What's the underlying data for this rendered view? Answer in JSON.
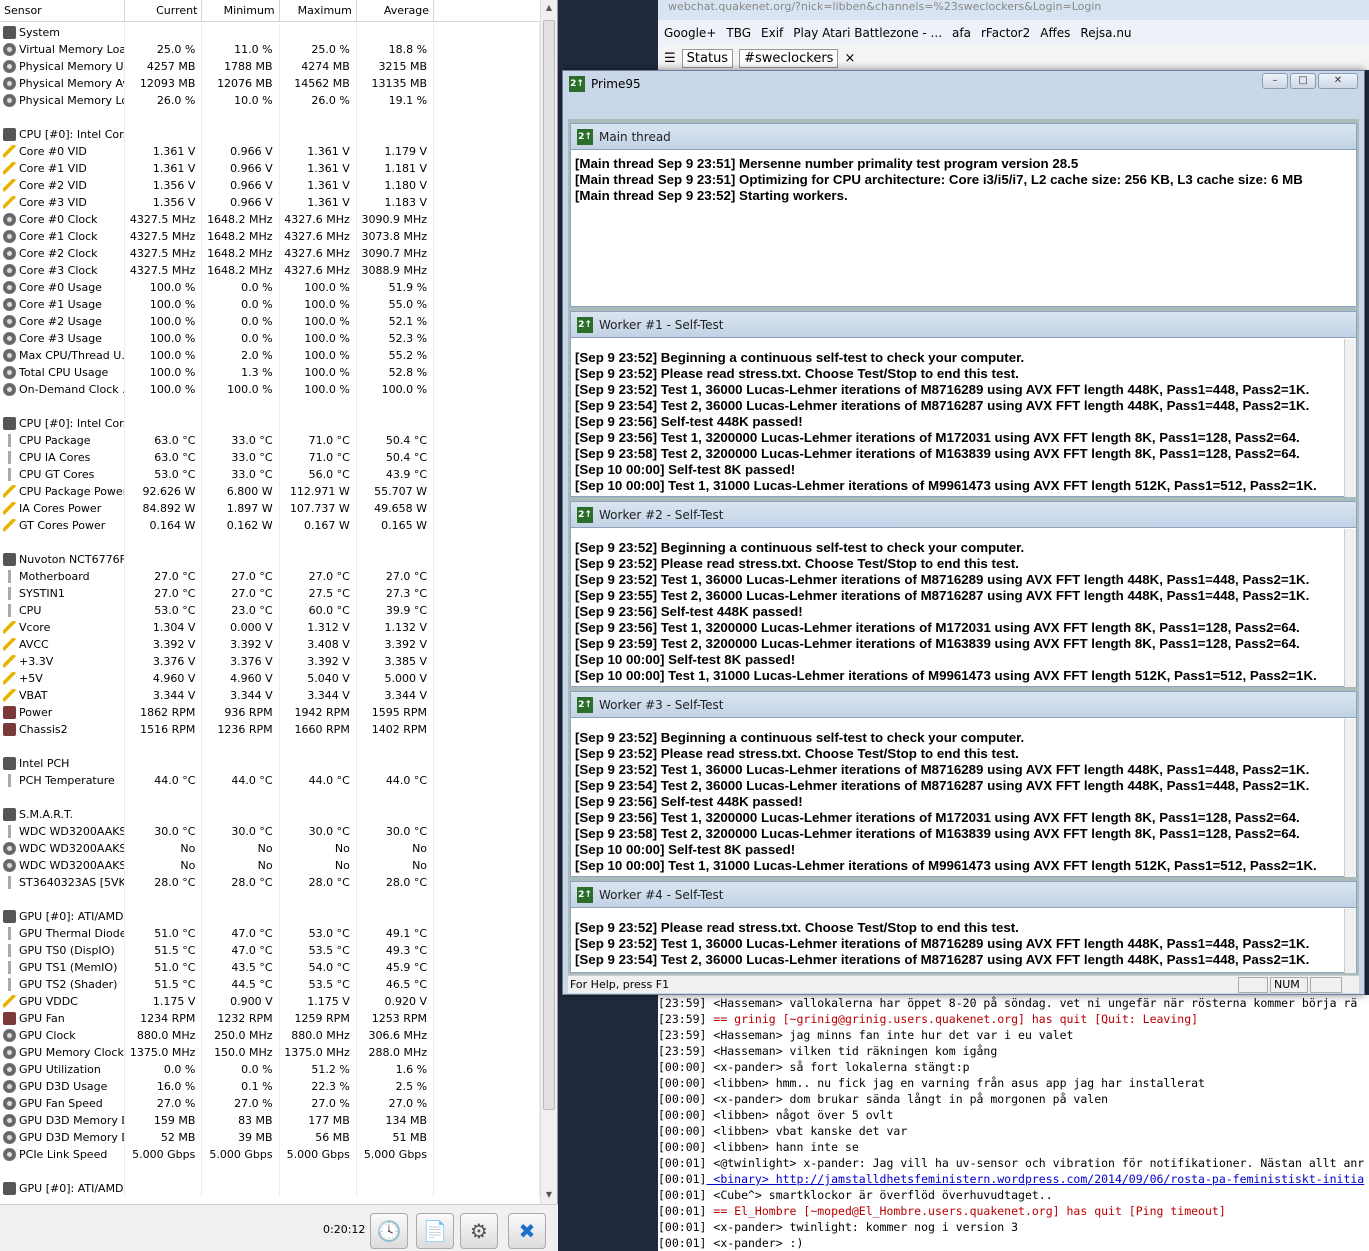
{
  "hwinfo": {
    "columns": [
      "Sensor",
      "Current",
      "Minimum",
      "Maximum",
      "Average"
    ],
    "rows": [
      {
        "icon": "chip",
        "name": "System",
        "cur": "",
        "min": "",
        "max": "",
        "avg": ""
      },
      {
        "icon": "disk",
        "name": "Virtual Memory Load",
        "cur": "25.0 %",
        "min": "11.0 %",
        "max": "25.0 %",
        "avg": "18.8 %"
      },
      {
        "icon": "disk",
        "name": "Physical Memory Used",
        "cur": "4257 MB",
        "min": "1788 MB",
        "max": "4274 MB",
        "avg": "3215 MB"
      },
      {
        "icon": "disk",
        "name": "Physical Memory Av...",
        "cur": "12093 MB",
        "min": "12076 MB",
        "max": "14562 MB",
        "avg": "13135 MB"
      },
      {
        "icon": "disk",
        "name": "Physical Memory Load",
        "cur": "26.0 %",
        "min": "10.0 %",
        "max": "26.0 %",
        "avg": "19.1 %"
      },
      {
        "icon": "",
        "name": "",
        "cur": "",
        "min": "",
        "max": "",
        "avg": ""
      },
      {
        "icon": "chip",
        "name": "CPU [#0]: Intel Cor...",
        "cur": "",
        "min": "",
        "max": "",
        "avg": ""
      },
      {
        "icon": "bolt",
        "name": "Core #0 VID",
        "cur": "1.361 V",
        "min": "0.966 V",
        "max": "1.361 V",
        "avg": "1.179 V"
      },
      {
        "icon": "bolt",
        "name": "Core #1 VID",
        "cur": "1.361 V",
        "min": "0.966 V",
        "max": "1.361 V",
        "avg": "1.181 V"
      },
      {
        "icon": "bolt",
        "name": "Core #2 VID",
        "cur": "1.356 V",
        "min": "0.966 V",
        "max": "1.361 V",
        "avg": "1.180 V"
      },
      {
        "icon": "bolt",
        "name": "Core #3 VID",
        "cur": "1.356 V",
        "min": "0.966 V",
        "max": "1.361 V",
        "avg": "1.183 V"
      },
      {
        "icon": "disk",
        "name": "Core #0 Clock",
        "cur": "4327.5 MHz",
        "min": "1648.2 MHz",
        "max": "4327.6 MHz",
        "avg": "3090.9 MHz"
      },
      {
        "icon": "disk",
        "name": "Core #1 Clock",
        "cur": "4327.5 MHz",
        "min": "1648.2 MHz",
        "max": "4327.6 MHz",
        "avg": "3073.8 MHz"
      },
      {
        "icon": "disk",
        "name": "Core #2 Clock",
        "cur": "4327.5 MHz",
        "min": "1648.2 MHz",
        "max": "4327.6 MHz",
        "avg": "3090.7 MHz"
      },
      {
        "icon": "disk",
        "name": "Core #3 Clock",
        "cur": "4327.5 MHz",
        "min": "1648.2 MHz",
        "max": "4327.6 MHz",
        "avg": "3088.9 MHz"
      },
      {
        "icon": "disk",
        "name": "Core #0 Usage",
        "cur": "100.0 %",
        "min": "0.0 %",
        "max": "100.0 %",
        "avg": "51.9 %"
      },
      {
        "icon": "disk",
        "name": "Core #1 Usage",
        "cur": "100.0 %",
        "min": "0.0 %",
        "max": "100.0 %",
        "avg": "55.0 %"
      },
      {
        "icon": "disk",
        "name": "Core #2 Usage",
        "cur": "100.0 %",
        "min": "0.0 %",
        "max": "100.0 %",
        "avg": "52.1 %"
      },
      {
        "icon": "disk",
        "name": "Core #3 Usage",
        "cur": "100.0 %",
        "min": "0.0 %",
        "max": "100.0 %",
        "avg": "52.3 %"
      },
      {
        "icon": "disk",
        "name": "Max CPU/Thread U...",
        "cur": "100.0 %",
        "min": "2.0 %",
        "max": "100.0 %",
        "avg": "55.2 %"
      },
      {
        "icon": "disk",
        "name": "Total CPU Usage",
        "cur": "100.0 %",
        "min": "1.3 %",
        "max": "100.0 %",
        "avg": "52.8 %"
      },
      {
        "icon": "disk",
        "name": "On-Demand Clock ...",
        "cur": "100.0 %",
        "min": "100.0 %",
        "max": "100.0 %",
        "avg": "100.0 %"
      },
      {
        "icon": "",
        "name": "",
        "cur": "",
        "min": "",
        "max": "",
        "avg": ""
      },
      {
        "icon": "chip",
        "name": "CPU [#0]: Intel Cor...",
        "cur": "",
        "min": "",
        "max": "",
        "avg": ""
      },
      {
        "icon": "therm",
        "name": "CPU Package",
        "cur": "63.0 °C",
        "min": "33.0 °C",
        "max": "71.0 °C",
        "avg": "50.4 °C"
      },
      {
        "icon": "therm",
        "name": "CPU IA Cores",
        "cur": "63.0 °C",
        "min": "33.0 °C",
        "max": "71.0 °C",
        "avg": "50.4 °C"
      },
      {
        "icon": "therm",
        "name": "CPU GT Cores",
        "cur": "53.0 °C",
        "min": "33.0 °C",
        "max": "56.0 °C",
        "avg": "43.9 °C"
      },
      {
        "icon": "bolt",
        "name": "CPU Package Power",
        "cur": "92.626 W",
        "min": "6.800 W",
        "max": "112.971 W",
        "avg": "55.707 W"
      },
      {
        "icon": "bolt",
        "name": "IA Cores Power",
        "cur": "84.892 W",
        "min": "1.897 W",
        "max": "107.737 W",
        "avg": "49.658 W"
      },
      {
        "icon": "bolt",
        "name": "GT Cores Power",
        "cur": "0.164 W",
        "min": "0.162 W",
        "max": "0.167 W",
        "avg": "0.165 W"
      },
      {
        "icon": "",
        "name": "",
        "cur": "",
        "min": "",
        "max": "",
        "avg": ""
      },
      {
        "icon": "chip",
        "name": "Nuvoton NCT6776F",
        "cur": "",
        "min": "",
        "max": "",
        "avg": ""
      },
      {
        "icon": "therm",
        "name": "Motherboard",
        "cur": "27.0 °C",
        "min": "27.0 °C",
        "max": "27.0 °C",
        "avg": "27.0 °C"
      },
      {
        "icon": "therm",
        "name": "SYSTIN1",
        "cur": "27.0 °C",
        "min": "27.0 °C",
        "max": "27.5 °C",
        "avg": "27.3 °C"
      },
      {
        "icon": "therm",
        "name": "CPU",
        "cur": "53.0 °C",
        "min": "23.0 °C",
        "max": "60.0 °C",
        "avg": "39.9 °C"
      },
      {
        "icon": "bolt",
        "name": "Vcore",
        "cur": "1.304 V",
        "min": "0.000 V",
        "max": "1.312 V",
        "avg": "1.132 V"
      },
      {
        "icon": "bolt",
        "name": "AVCC",
        "cur": "3.392 V",
        "min": "3.392 V",
        "max": "3.408 V",
        "avg": "3.392 V"
      },
      {
        "icon": "bolt",
        "name": "+3.3V",
        "cur": "3.376 V",
        "min": "3.376 V",
        "max": "3.392 V",
        "avg": "3.385 V"
      },
      {
        "icon": "bolt",
        "name": "+5V",
        "cur": "4.960 V",
        "min": "4.960 V",
        "max": "5.040 V",
        "avg": "5.000 V"
      },
      {
        "icon": "bolt",
        "name": "VBAT",
        "cur": "3.344 V",
        "min": "3.344 V",
        "max": "3.344 V",
        "avg": "3.344 V"
      },
      {
        "icon": "fan",
        "name": "Power",
        "cur": "1862 RPM",
        "min": "936 RPM",
        "max": "1942 RPM",
        "avg": "1595 RPM"
      },
      {
        "icon": "fan",
        "name": "Chassis2",
        "cur": "1516 RPM",
        "min": "1236 RPM",
        "max": "1660 RPM",
        "avg": "1402 RPM"
      },
      {
        "icon": "",
        "name": "",
        "cur": "",
        "min": "",
        "max": "",
        "avg": ""
      },
      {
        "icon": "chip",
        "name": "Intel PCH",
        "cur": "",
        "min": "",
        "max": "",
        "avg": ""
      },
      {
        "icon": "therm",
        "name": "PCH Temperature",
        "cur": "44.0 °C",
        "min": "44.0 °C",
        "max": "44.0 °C",
        "avg": "44.0 °C"
      },
      {
        "icon": "",
        "name": "",
        "cur": "",
        "min": "",
        "max": "",
        "avg": ""
      },
      {
        "icon": "chip",
        "name": "S.M.A.R.T.",
        "cur": "",
        "min": "",
        "max": "",
        "avg": ""
      },
      {
        "icon": "therm",
        "name": "WDC WD3200AAKS...",
        "cur": "30.0 °C",
        "min": "30.0 °C",
        "max": "30.0 °C",
        "avg": "30.0 °C"
      },
      {
        "icon": "disk",
        "name": "WDC WD3200AAKS...",
        "cur": "No",
        "min": "No",
        "max": "No",
        "avg": "No"
      },
      {
        "icon": "disk",
        "name": "WDC WD3200AAKS...",
        "cur": "No",
        "min": "No",
        "max": "No",
        "avg": "No"
      },
      {
        "icon": "therm",
        "name": "ST3640323AS [5VK...",
        "cur": "28.0 °C",
        "min": "28.0 °C",
        "max": "28.0 °C",
        "avg": "28.0 °C"
      },
      {
        "icon": "",
        "name": "",
        "cur": "",
        "min": "",
        "max": "",
        "avg": ""
      },
      {
        "icon": "chip",
        "name": "GPU [#0]: ATI/AMD...",
        "cur": "",
        "min": "",
        "max": "",
        "avg": ""
      },
      {
        "icon": "therm",
        "name": "GPU Thermal Diode",
        "cur": "51.0 °C",
        "min": "47.0 °C",
        "max": "53.0 °C",
        "avg": "49.1 °C"
      },
      {
        "icon": "therm",
        "name": "GPU TS0 (DispIO)",
        "cur": "51.5 °C",
        "min": "47.0 °C",
        "max": "53.5 °C",
        "avg": "49.3 °C"
      },
      {
        "icon": "therm",
        "name": "GPU TS1 (MemIO)",
        "cur": "51.0 °C",
        "min": "43.5 °C",
        "max": "54.0 °C",
        "avg": "45.9 °C"
      },
      {
        "icon": "therm",
        "name": "GPU TS2 (Shader)",
        "cur": "51.5 °C",
        "min": "44.5 °C",
        "max": "53.5 °C",
        "avg": "46.5 °C"
      },
      {
        "icon": "bolt",
        "name": "GPU VDDC",
        "cur": "1.175 V",
        "min": "0.900 V",
        "max": "1.175 V",
        "avg": "0.920 V"
      },
      {
        "icon": "fan",
        "name": "GPU Fan",
        "cur": "1234 RPM",
        "min": "1232 RPM",
        "max": "1259 RPM",
        "avg": "1253 RPM"
      },
      {
        "icon": "disk",
        "name": "GPU Clock",
        "cur": "880.0 MHz",
        "min": "250.0 MHz",
        "max": "880.0 MHz",
        "avg": "306.6 MHz"
      },
      {
        "icon": "disk",
        "name": "GPU Memory Clock",
        "cur": "1375.0 MHz",
        "min": "150.0 MHz",
        "max": "1375.0 MHz",
        "avg": "288.0 MHz"
      },
      {
        "icon": "disk",
        "name": "GPU Utilization",
        "cur": "0.0 %",
        "min": "0.0 %",
        "max": "51.2 %",
        "avg": "1.6 %"
      },
      {
        "icon": "disk",
        "name": "GPU D3D Usage",
        "cur": "16.0 %",
        "min": "0.1 %",
        "max": "22.3 %",
        "avg": "2.5 %"
      },
      {
        "icon": "disk",
        "name": "GPU Fan Speed",
        "cur": "27.0 %",
        "min": "27.0 %",
        "max": "27.0 %",
        "avg": "27.0 %"
      },
      {
        "icon": "disk",
        "name": "GPU D3D Memory D...",
        "cur": "159 MB",
        "min": "83 MB",
        "max": "177 MB",
        "avg": "134 MB"
      },
      {
        "icon": "disk",
        "name": "GPU D3D Memory D...",
        "cur": "52 MB",
        "min": "39 MB",
        "max": "56 MB",
        "avg": "51 MB"
      },
      {
        "icon": "disk",
        "name": "PCIe Link Speed",
        "cur": "5.000 Gbps",
        "min": "5.000 Gbps",
        "max": "5.000 Gbps",
        "avg": "5.000 Gbps"
      },
      {
        "icon": "",
        "name": "",
        "cur": "",
        "min": "",
        "max": "",
        "avg": ""
      },
      {
        "icon": "chip",
        "name": "GPU [#0]: ATI/AMD...",
        "cur": "",
        "min": "",
        "max": "",
        "avg": ""
      }
    ],
    "elapsed": "0:20:12"
  },
  "browser": {
    "url": "webchat.quakenet.org/?nick=libben&channels=%23sweclockers&Login=Login",
    "bookmarks": [
      "Google+",
      "TBG",
      "Exif",
      "Play Atari Battlezone - ...",
      "afa",
      "rFactor2",
      "Affes",
      "Rejsa.nu"
    ],
    "irc_tabs": [
      "Status",
      "#sweclockers"
    ],
    "chat": [
      {
        "t": "[23:59]",
        "txt": " <Hasseman> vallokalerna har öppet 8-20 på söndag. vet ni ungefär när rösterna kommer börja rä",
        "cls": ""
      },
      {
        "t": "[23:59]",
        "txt": " == grinig [~grinig@grinig.users.quakenet.org] has quit [Quit: Leaving]",
        "cls": "quit"
      },
      {
        "t": "[23:59]",
        "txt": " <Hasseman> jag minns fan inte hur det var i eu valet",
        "cls": ""
      },
      {
        "t": "[23:59]",
        "txt": " <Hasseman> vilken tid räkningen kom igång",
        "cls": ""
      },
      {
        "t": "[00:00]",
        "txt": " <x-pander> så fort lokalerna stängt:p",
        "cls": ""
      },
      {
        "t": "[00:00]",
        "txt": " <libben> hmm.. nu fick jag en varning från asus app jag har installerat",
        "cls": ""
      },
      {
        "t": "[00:00]",
        "txt": " <x-pander> dom brukar sända långt in på morgonen på valen",
        "cls": ""
      },
      {
        "t": "[00:00]",
        "txt": " <libben> något över 5 ovlt",
        "cls": ""
      },
      {
        "t": "[00:00]",
        "txt": " <libben> vbat kanske det var",
        "cls": ""
      },
      {
        "t": "[00:00]",
        "txt": " <libben> hann inte se",
        "cls": ""
      },
      {
        "t": "[00:01]",
        "txt": " <@twinlight> x-pander: Jag vill ha uv-sensor och vibration för notifikationer. Nästan allt anr",
        "cls": ""
      },
      {
        "t": "[00:01]",
        "txt": " <binary> http://jamstalldhetsfeministern.wordpress.com/2014/09/06/rosta-pa-feministiskt-initia",
        "cls": "link"
      },
      {
        "t": "[00:01]",
        "txt": " <Cube^> smartklockor är överflöd överhuvudtaget..",
        "cls": ""
      },
      {
        "t": "[00:01]",
        "txt": " == El_Hombre [~moped@El_Hombre.users.quakenet.org] has quit [Ping timeout]",
        "cls": "quit"
      },
      {
        "t": "[00:01]",
        "txt": " <x-pander> twinlight: kommer nog i version 3",
        "cls": ""
      },
      {
        "t": "[00:01]",
        "txt": " <x-pander> :)",
        "cls": ""
      }
    ]
  },
  "prime95": {
    "title": "Prime95",
    "status": "For Help, press F1",
    "num": "NUM",
    "main": {
      "title": "Main thread",
      "lines": [
        "[Main thread Sep 9 23:51] Mersenne number primality test program version 28.5",
        "[Main thread Sep 9 23:51] Optimizing for CPU architecture: Core i3/i5/i7, L2 cache size: 256 KB, L3 cache size: 6 MB",
        "[Main thread Sep 9 23:52] Starting workers."
      ]
    },
    "workers": [
      {
        "title": "Worker #1 - Self-Test",
        "lines": [
          "[Sep 9 23:52] Beginning a continuous self-test to check your computer.",
          "[Sep 9 23:52] Please read stress.txt.  Choose Test/Stop to end this test.",
          "[Sep 9 23:52] Test 1, 36000 Lucas-Lehmer iterations of M8716289 using AVX FFT length 448K, Pass1=448, Pass2=1K.",
          "[Sep 9 23:54] Test 2, 36000 Lucas-Lehmer iterations of M8716287 using AVX FFT length 448K, Pass1=448, Pass2=1K.",
          "[Sep 9 23:56] Self-test 448K passed!",
          "[Sep 9 23:56] Test 1, 3200000 Lucas-Lehmer iterations of M172031 using AVX FFT length 8K, Pass1=128, Pass2=64.",
          "[Sep 9 23:58] Test 2, 3200000 Lucas-Lehmer iterations of M163839 using AVX FFT length 8K, Pass1=128, Pass2=64.",
          "[Sep 10 00:00] Self-test 8K passed!",
          "[Sep 10 00:00] Test 1, 31000 Lucas-Lehmer iterations of M9961473 using AVX FFT length 512K, Pass1=512, Pass2=1K."
        ]
      },
      {
        "title": "Worker #2 - Self-Test",
        "lines": [
          "[Sep 9 23:52] Beginning a continuous self-test to check your computer.",
          "[Sep 9 23:52] Please read stress.txt.  Choose Test/Stop to end this test.",
          "[Sep 9 23:52] Test 1, 36000 Lucas-Lehmer iterations of M8716289 using AVX FFT length 448K, Pass1=448, Pass2=1K.",
          "[Sep 9 23:55] Test 2, 36000 Lucas-Lehmer iterations of M8716287 using AVX FFT length 448K, Pass1=448, Pass2=1K.",
          "[Sep 9 23:56] Self-test 448K passed!",
          "[Sep 9 23:56] Test 1, 3200000 Lucas-Lehmer iterations of M172031 using AVX FFT length 8K, Pass1=128, Pass2=64.",
          "[Sep 9 23:59] Test 2, 3200000 Lucas-Lehmer iterations of M163839 using AVX FFT length 8K, Pass1=128, Pass2=64.",
          "[Sep 10 00:00] Self-test 8K passed!",
          "[Sep 10 00:00] Test 1, 31000 Lucas-Lehmer iterations of M9961473 using AVX FFT length 512K, Pass1=512, Pass2=1K."
        ]
      },
      {
        "title": "Worker #3 - Self-Test",
        "lines": [
          "[Sep 9 23:52] Beginning a continuous self-test to check your computer.",
          "[Sep 9 23:52] Please read stress.txt.  Choose Test/Stop to end this test.",
          "[Sep 9 23:52] Test 1, 36000 Lucas-Lehmer iterations of M8716289 using AVX FFT length 448K, Pass1=448, Pass2=1K.",
          "[Sep 9 23:54] Test 2, 36000 Lucas-Lehmer iterations of M8716287 using AVX FFT length 448K, Pass1=448, Pass2=1K.",
          "[Sep 9 23:56] Self-test 448K passed!",
          "[Sep 9 23:56] Test 1, 3200000 Lucas-Lehmer iterations of M172031 using AVX FFT length 8K, Pass1=128, Pass2=64.",
          "[Sep 9 23:58] Test 2, 3200000 Lucas-Lehmer iterations of M163839 using AVX FFT length 8K, Pass1=128, Pass2=64.",
          "[Sep 10 00:00] Self-test 8K passed!",
          "[Sep 10 00:00] Test 1, 31000 Lucas-Lehmer iterations of M9961473 using AVX FFT length 512K, Pass1=512, Pass2=1K."
        ]
      },
      {
        "title": "Worker #4 - Self-Test",
        "lines": [
          "[Sep 9 23:52] Please read stress.txt.  Choose Test/Stop to end this test.",
          "[Sep 9 23:52] Test 1, 36000 Lucas-Lehmer iterations of M8716289 using AVX FFT length 448K, Pass1=448, Pass2=1K.",
          "[Sep 9 23:54] Test 2, 36000 Lucas-Lehmer iterations of M8716287 using AVX FFT length 448K, Pass1=448, Pass2=1K."
        ]
      }
    ]
  }
}
